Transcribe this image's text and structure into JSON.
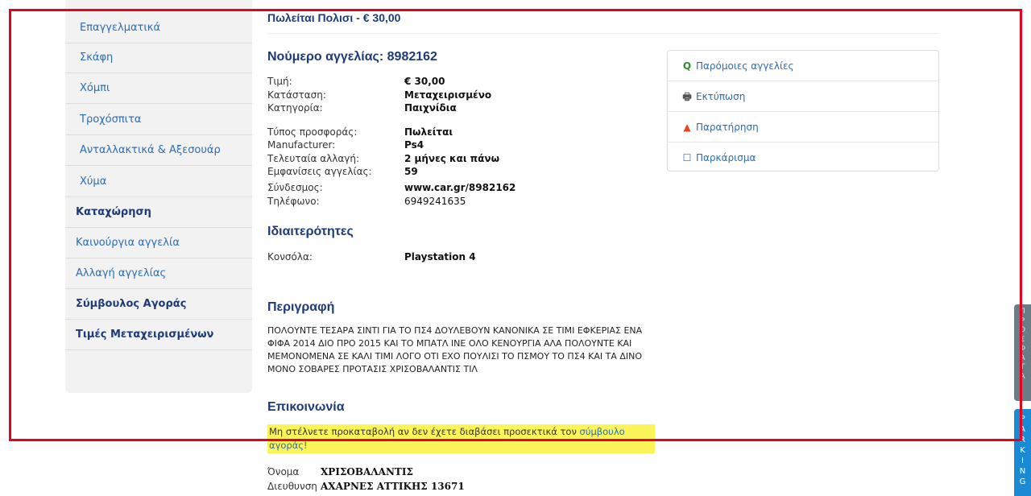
{
  "sidebar": {
    "items": [
      {
        "label": "Επαγγελματικά"
      },
      {
        "label": "Σκάφη"
      },
      {
        "label": "Χόμπι"
      },
      {
        "label": "Τροχόσπιτα"
      },
      {
        "label": "Ανταλλακτικά & Αξεσουάρ"
      },
      {
        "label": "Χύμα"
      },
      {
        "label": "Καταχώρηση"
      },
      {
        "label": "Καινούργια αγγελία"
      },
      {
        "label": "Αλλαγή αγγελίας"
      },
      {
        "label": "Σύμβουλος Αγοράς"
      },
      {
        "label": "Τιμές Μεταχειρισμένων"
      }
    ]
  },
  "listing": {
    "sold_title": "Πωλείται Πολισι - € 30,00",
    "ad_number_heading": "Νούμερο αγγελίας: 8982162",
    "details": [
      {
        "key": "Τιμή:",
        "value": "€ 30,00"
      },
      {
        "key": "Κατάσταση:",
        "value": "Μεταχειρισμένο"
      },
      {
        "key": "Κατηγορία:",
        "value": "Παιχνίδια"
      },
      {
        "key": "Τύπος προσφοράς:",
        "value": "Πωλείται"
      },
      {
        "key": "Manufacturer:",
        "value": "Ps4"
      },
      {
        "key": "Τελευταία αλλαγή:",
        "value": "2 μήνες και πάνω"
      },
      {
        "key": "Εμφανίσεις αγγελίας:",
        "value": "59"
      },
      {
        "key": "Σύνδεσμος:",
        "value": "www.car.gr/8982162"
      },
      {
        "key": "Τηλέφωνο:",
        "value": "6949241635"
      }
    ],
    "features_heading": "Ιδιαιτερότητες",
    "features": [
      {
        "key": "Κονσόλα:",
        "value": "Playstation 4"
      }
    ],
    "description_heading": "Περιγραφή",
    "description": "ΠΟΛΟΥΝΤΕ ΤΕΣΑΡΑ ΣΙΝΤΙ ΓΙΑ ΤΟ ΠΣ4 ΔΟΥΛΕΒΟΥΝ ΚΑΝΟΝΙΚΑ ΣΕ ΤΙΜΙ ΕΦΚΕΡΙΑΣ ΕΝΑ ΦΙΦΑ 2014 ΔΙΟ ΠΡΟ 2015 ΚΑΙ ΤΟ ΜΠΑΤΛ ΙΝΕ ΟΛΟ ΚΕΝΟΥΡΓΙΑ ΑΛΑ ΠΟΛΟΥΝΤΕ ΚΑΙ ΜΕΜΟΝΟΜΕΝΑ ΣΕ ΚΑΛΙ ΤΙΜΙ ΛΟΓΟ ΟΤΙ ΕΧΟ ΠΟΥΛΙΣΙ ΤΟ ΠΣΜΟΥ ΤΟ ΠΣ4 ΚΑΙ ΤΑ ΔΙΝΟ ΜΟΝΟ ΣΟΒΑΡΕΣ ΠΡΟΤΑΣΙΣ ΧΡΙΣΟΒΑΛΑΝΤΙΣ ΤΙΛ",
    "contact_heading": "Επικοινωνία",
    "warning_text": "Μη στέλνετε προκαταβολή αν δεν έχετε διαβάσει προσεκτικά τον ",
    "warning_link": "σύμβουλο αγοράς!",
    "contact": [
      {
        "key": "Όνομα",
        "value": "ΧΡΙΣΟΒΑΛΑΝΤΙΣ"
      },
      {
        "key": "Διευθυνση",
        "value": "ΑΧΑΡΝΕΣ ΑΤΤΙΚΗΣ 13671"
      }
    ]
  },
  "actions": [
    {
      "label": "Παρόμοιες αγγελίες",
      "icon": "search-icon",
      "icon_glyph": "Q",
      "icon_color": "#2e8b2e"
    },
    {
      "label": "Εκτύπωση",
      "icon": "print-icon",
      "icon_glyph": "🖶",
      "icon_color": "#555555"
    },
    {
      "label": "Παρατήρηση",
      "icon": "warning-icon",
      "icon_glyph": "▲",
      "icon_color": "#e8441e"
    },
    {
      "label": "Παρκάρισμα",
      "icon": "checkbox-icon",
      "icon_glyph": "☐",
      "icon_color": "#2a6db5"
    }
  ],
  "side_tabs": {
    "recent": [
      "Π",
      "Ρ",
      "Ο",
      "Σ",
      "Φ",
      "Α",
      "Τ",
      "Α"
    ],
    "parking": [
      "P",
      "A",
      "R",
      "K",
      "I",
      "N",
      "G"
    ]
  },
  "colors": {
    "link": "#2a6db5",
    "heading": "#1e3a7a",
    "warning_bg": "#fbf55a",
    "highlight": "#e8001c"
  }
}
